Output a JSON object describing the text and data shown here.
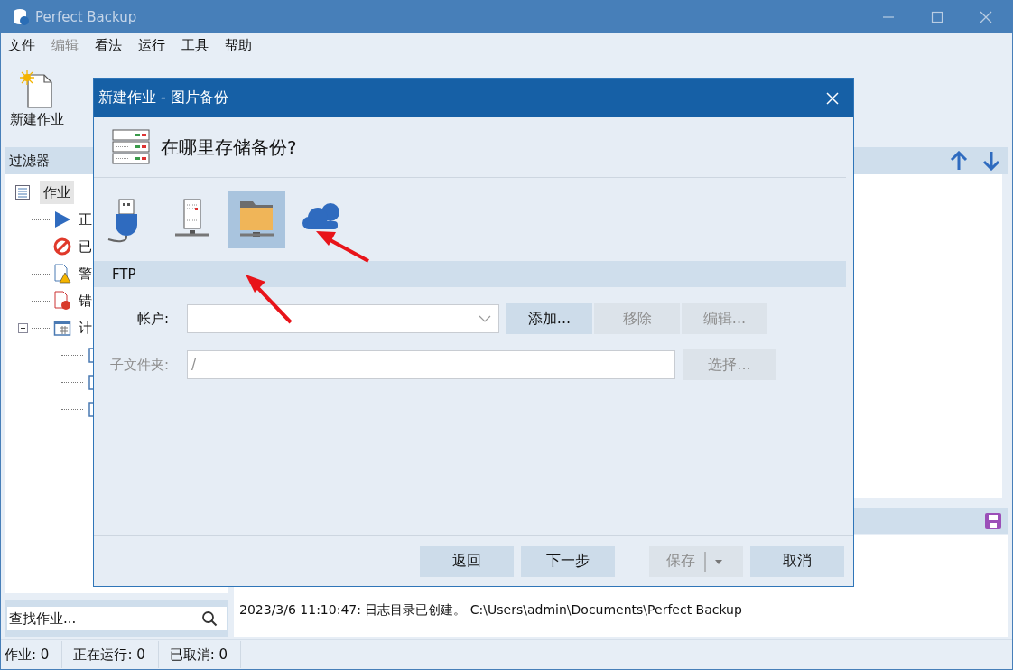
{
  "window": {
    "title": "Perfect Backup"
  },
  "menu": [
    {
      "label": "文件",
      "disabled": false
    },
    {
      "label": "编辑",
      "disabled": true
    },
    {
      "label": "看法",
      "disabled": false
    },
    {
      "label": "运行",
      "disabled": false
    },
    {
      "label": "工具",
      "disabled": false
    },
    {
      "label": "帮助",
      "disabled": false
    }
  ],
  "toolbar": [
    {
      "label": "新建作业",
      "kind": "new"
    }
  ],
  "filter_panel": {
    "title": "过滤器",
    "tree": [
      {
        "label": "作业",
        "kind": "jobs",
        "selected": true,
        "children": [
          {
            "label": "正",
            "kind": "running"
          },
          {
            "label": "已",
            "kind": "cancelled"
          },
          {
            "label": "警",
            "kind": "warning"
          },
          {
            "label": "错",
            "kind": "error"
          },
          {
            "label": "计",
            "kind": "schedule",
            "expanded": true,
            "children": [
              {
                "kind": "schedule-item"
              },
              {
                "kind": "schedule-item"
              },
              {
                "kind": "schedule-item"
              }
            ]
          }
        ]
      }
    ]
  },
  "search": {
    "placeholder": "查找作业..."
  },
  "log": {
    "lines": [
      "2023/3/6 11:10:47: 日志目录已创建。 C:\\Users\\admin\\Documents\\Perfect Backup"
    ]
  },
  "status_bar": [
    "作业: 0",
    "正在运行: 0",
    "已取消: 0"
  ],
  "dialog": {
    "title": "新建作业 - 图片备份",
    "heading": "在哪里存储备份?",
    "destinations": [
      {
        "kind": "usb",
        "selected": false
      },
      {
        "kind": "server",
        "selected": false
      },
      {
        "kind": "folder",
        "selected": true
      },
      {
        "kind": "cloud",
        "selected": false
      }
    ],
    "section": "FTP",
    "account": {
      "label": "帐户:",
      "disabled": false,
      "buttons": [
        {
          "label": "添加...",
          "disabled": false
        },
        {
          "label": "移除",
          "disabled": true
        },
        {
          "label": "编辑...",
          "disabled": true
        }
      ]
    },
    "subfolder": {
      "label": "子文件夹:",
      "value": "/",
      "disabled": true,
      "button": {
        "label": "选择...",
        "disabled": true
      }
    },
    "footer": [
      {
        "label": "返回",
        "disabled": false,
        "split": false
      },
      {
        "label": "下一步",
        "disabled": false,
        "split": false
      },
      {
        "label": "保存",
        "disabled": true,
        "split": true
      },
      {
        "label": "取消",
        "disabled": false,
        "split": false
      }
    ]
  }
}
